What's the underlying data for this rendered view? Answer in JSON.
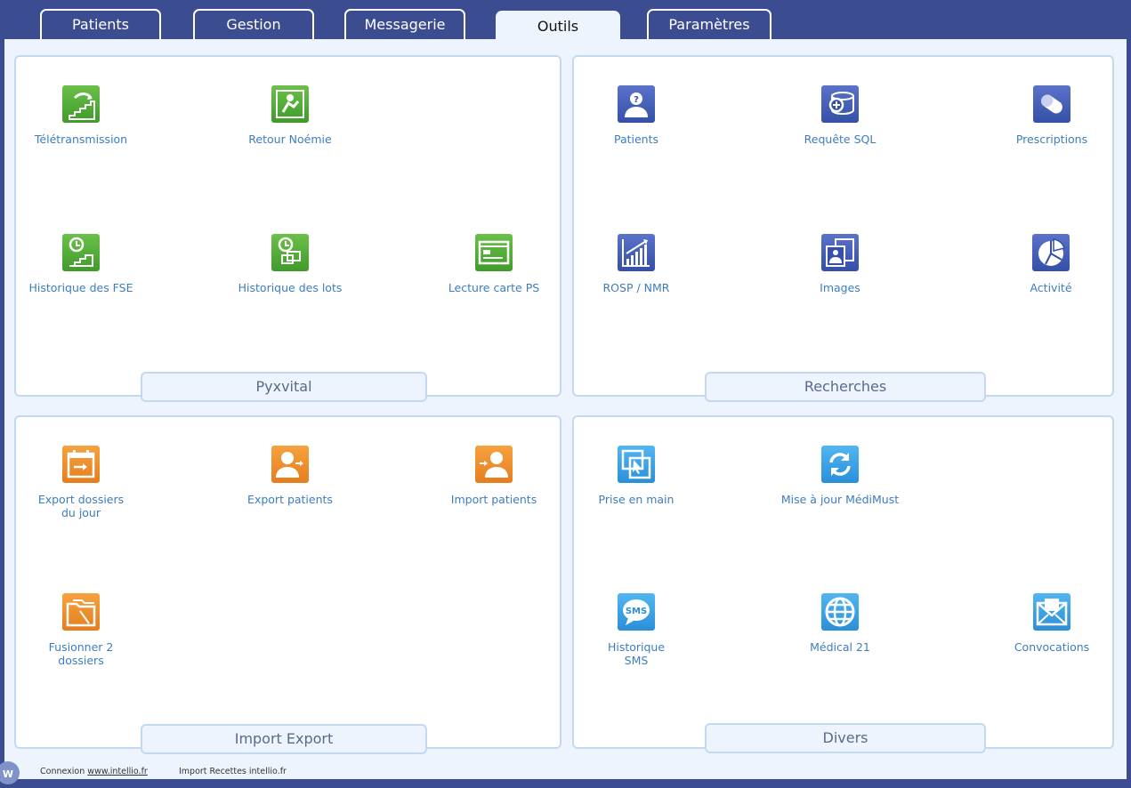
{
  "tabs": [
    {
      "label": "Patients",
      "active": false
    },
    {
      "label": "Gestion",
      "active": false
    },
    {
      "label": "Messagerie",
      "active": false
    },
    {
      "label": "Outils",
      "active": true
    },
    {
      "label": "Paramètres",
      "active": false
    }
  ],
  "panels": {
    "pyxvital": {
      "title": "Pyxvital",
      "tools": [
        {
          "label": "Télétransmission",
          "icon": "teletransmission-icon",
          "color": "#4fae35"
        },
        {
          "label": "Retour Noémie",
          "icon": "retour-noemie-icon",
          "color": "#4fae35"
        },
        {
          "label": "Historique des FSE",
          "icon": "historique-fse-icon",
          "color": "#4fae35"
        },
        {
          "label": "Historique des lots",
          "icon": "historique-lots-icon",
          "color": "#4fae35"
        },
        {
          "label": "Lecture carte PS",
          "icon": "carte-ps-icon",
          "color": "#4fae35"
        }
      ]
    },
    "recherches": {
      "title": "Recherches",
      "tools": [
        {
          "label": "Patients",
          "icon": "patient-search-icon",
          "color": "#4560b8"
        },
        {
          "label": "Requête SQL",
          "icon": "sql-query-icon",
          "color": "#4560b8"
        },
        {
          "label": "Prescriptions",
          "icon": "pill-icon",
          "color": "#4560b8"
        },
        {
          "label": "ROSP / NMR",
          "icon": "bar-chart-icon",
          "color": "#4560b8"
        },
        {
          "label": "Images",
          "icon": "images-icon",
          "color": "#4560b8"
        },
        {
          "label": "Activité",
          "icon": "pie-chart-icon",
          "color": "#4560b8"
        }
      ]
    },
    "import_export": {
      "title": "Import Export",
      "tools": [
        {
          "label1": "Export dossiers",
          "label2": "du jour",
          "icon": "export-dossiers-icon",
          "color": "#ee8a2a"
        },
        {
          "label": "Export patients",
          "icon": "export-patients-icon",
          "color": "#ee8a2a"
        },
        {
          "label": "Import patients",
          "icon": "import-patients-icon",
          "color": "#ee8a2a"
        },
        {
          "label1": "Fusionner 2",
          "label2": "dossiers",
          "icon": "merge-folders-icon",
          "color": "#ee8a2a"
        }
      ]
    },
    "divers": {
      "title": "Divers",
      "tools": [
        {
          "label": "Prise en main",
          "icon": "remote-control-icon",
          "color": "#3ba4e8"
        },
        {
          "label": "Mise à jour MédiMust",
          "icon": "update-icon",
          "color": "#3ba4e8"
        },
        {
          "label1": "Historique",
          "label2": "SMS",
          "icon": "sms-icon",
          "color": "#3ba4e8"
        },
        {
          "label": "Médical 21",
          "icon": "globe-icon",
          "color": "#3ba4e8"
        },
        {
          "label": "Convocations",
          "icon": "envelope-icon",
          "color": "#3ba4e8"
        }
      ]
    }
  },
  "footer": {
    "connexion_label": "Connexion",
    "connexion_link": "www.intellio.fr",
    "import_label": "Import Recettes intellio.fr",
    "logo_letter": "W"
  }
}
